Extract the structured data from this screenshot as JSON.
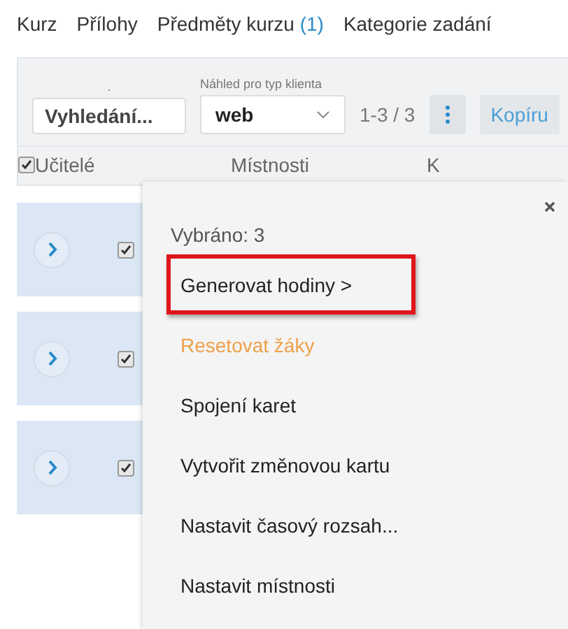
{
  "tabs": [
    {
      "label": "Kurz"
    },
    {
      "label": "Přílohy"
    },
    {
      "label": "Předměty kurzu",
      "count": "(1)"
    },
    {
      "label": "Kategorie zadání"
    }
  ],
  "toolbar": {
    "search": {
      "label": ".",
      "placeholder": "Vyhledání..."
    },
    "client_type": {
      "label": "Náhled pro typ klienta",
      "value": "web"
    },
    "range": "1-3 / 3",
    "copy_button": "Kopíru"
  },
  "table": {
    "select_all": {
      "checked": true
    },
    "columns": [
      "Učitelé",
      "Místnosti",
      "K"
    ],
    "rows": [
      {
        "checked": true
      },
      {
        "checked": true
      },
      {
        "checked": true
      }
    ]
  },
  "popup": {
    "title": "Vybráno: 3",
    "items": [
      {
        "label": "Generovat hodiny >",
        "kind": "normal",
        "highlighted": true
      },
      {
        "label": "Resetovat žáky",
        "kind": "warning",
        "highlighted": false
      },
      {
        "label": "Spojení karet",
        "kind": "normal",
        "highlighted": false
      },
      {
        "label": "Vytvořit změnovou kartu",
        "kind": "normal",
        "highlighted": false
      },
      {
        "label": "Nastavit časový rozsah...",
        "kind": "normal",
        "highlighted": false
      },
      {
        "label": "Nastavit místnosti",
        "kind": "normal",
        "highlighted": false
      }
    ]
  }
}
